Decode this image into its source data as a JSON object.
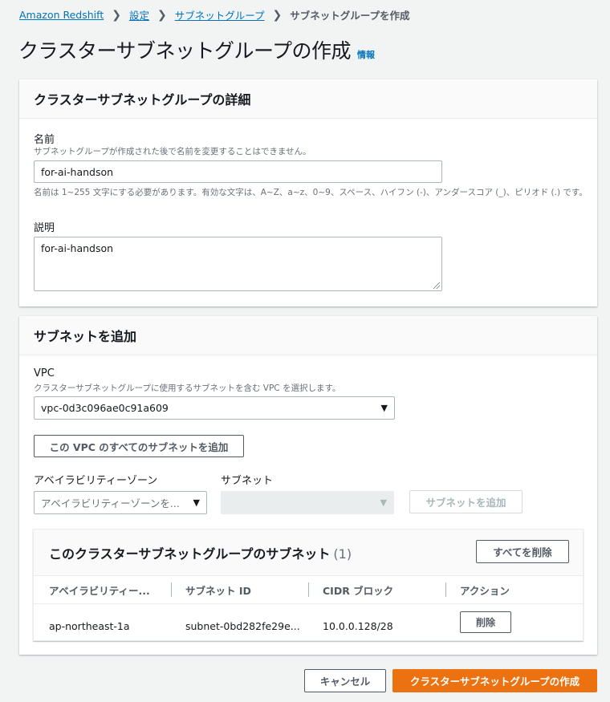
{
  "breadcrumb": {
    "items": [
      "Amazon Redshift",
      "設定",
      "サブネットグループ"
    ],
    "current": "サブネットグループを作成"
  },
  "page": {
    "title": "クラスターサブネットグループの作成",
    "info": "情報"
  },
  "details": {
    "header": "クラスターサブネットグループの詳細",
    "name_label": "名前",
    "name_desc": "サブネットグループが作成された後で名前を変更することはできません。",
    "name_value": "for-ai-handson",
    "name_constraint": "名前は 1~255 文字にする必要があります。有効な文字は、A~Z、a~z、0~9、スペース、ハイフン (-)、アンダースコア (_)、ピリオド (.) です。",
    "desc_label": "説明",
    "desc_value": "for-ai-handson"
  },
  "add_subnets": {
    "header": "サブネットを追加",
    "vpc_label": "VPC",
    "vpc_desc": "クラスターサブネットグループに使用するサブネットを含む VPC を選択します。",
    "vpc_value": "vpc-0d3c096ae0c91a609",
    "add_all_button": "この VPC のすべてのサブネットを追加",
    "az_label": "アベイラビリティーゾーン",
    "az_placeholder": "アベイラビリティーゾーンを...",
    "subnet_label": "サブネット",
    "subnet_value": "",
    "add_subnet_button": "サブネットを追加"
  },
  "subnet_table": {
    "title": "このクラスターサブネットグループのサブネット",
    "count": "(1)",
    "remove_all_button": "すべてを削除",
    "columns": [
      "アベイラビリティー...",
      "サブネット ID",
      "CIDR ブロック",
      "アクション"
    ],
    "rows": [
      {
        "az": "ap-northeast-1a",
        "subnet_id": "subnet-0bd282fe29e...",
        "cidr": "10.0.0.128/28",
        "action": "削除"
      }
    ]
  },
  "footer": {
    "cancel": "キャンセル",
    "create": "クラスターサブネットグループの作成"
  },
  "colors": {
    "accent": "#ec7211",
    "link": "#0073bb",
    "background": "#f2f3f3"
  }
}
